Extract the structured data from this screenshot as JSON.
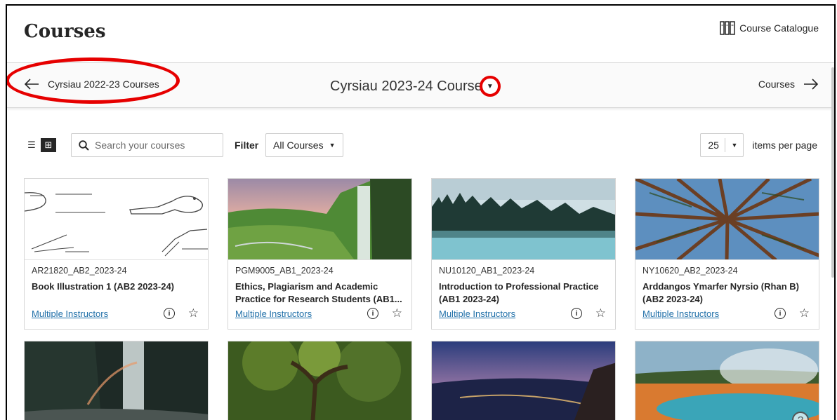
{
  "header": {
    "title": "Courses",
    "catalogue_label": "Course Catalogue"
  },
  "term_nav": {
    "previous_label": "Cyrsiau 2022-23 Courses",
    "current_label": "Cyrsiau 2023-24 Course",
    "next_label": "Courses"
  },
  "toolbar": {
    "search_placeholder": "Search your courses",
    "filter_label": "Filter",
    "filter_value": "All Courses",
    "per_page_value": "25",
    "per_page_label": "items per page"
  },
  "cards": [
    {
      "code": "AR21820_AB2_2023-24",
      "name": "Book Illustration 1 (AB2 2023-24)",
      "instructors": "Multiple Instructors"
    },
    {
      "code": "PGM9005_AB1_2023-24",
      "name": "Ethics, Plagiarism and Academic Practice for Research Students (AB1...",
      "instructors": "Multiple Instructors"
    },
    {
      "code": "NU10120_AB1_2023-24",
      "name": "Introduction to Professional Practice (AB1 2023-24)",
      "instructors": "Multiple Instructors"
    },
    {
      "code": "NY10620_AB2_2023-24",
      "name": "Arddangos Ymarfer Nyrsio (Rhan B) (AB2 2023-24)",
      "instructors": "Multiple Instructors"
    }
  ],
  "help": {
    "label": "?"
  },
  "colors": {
    "annotation_red": "#e60000",
    "link_blue": "#1f6fa8"
  }
}
